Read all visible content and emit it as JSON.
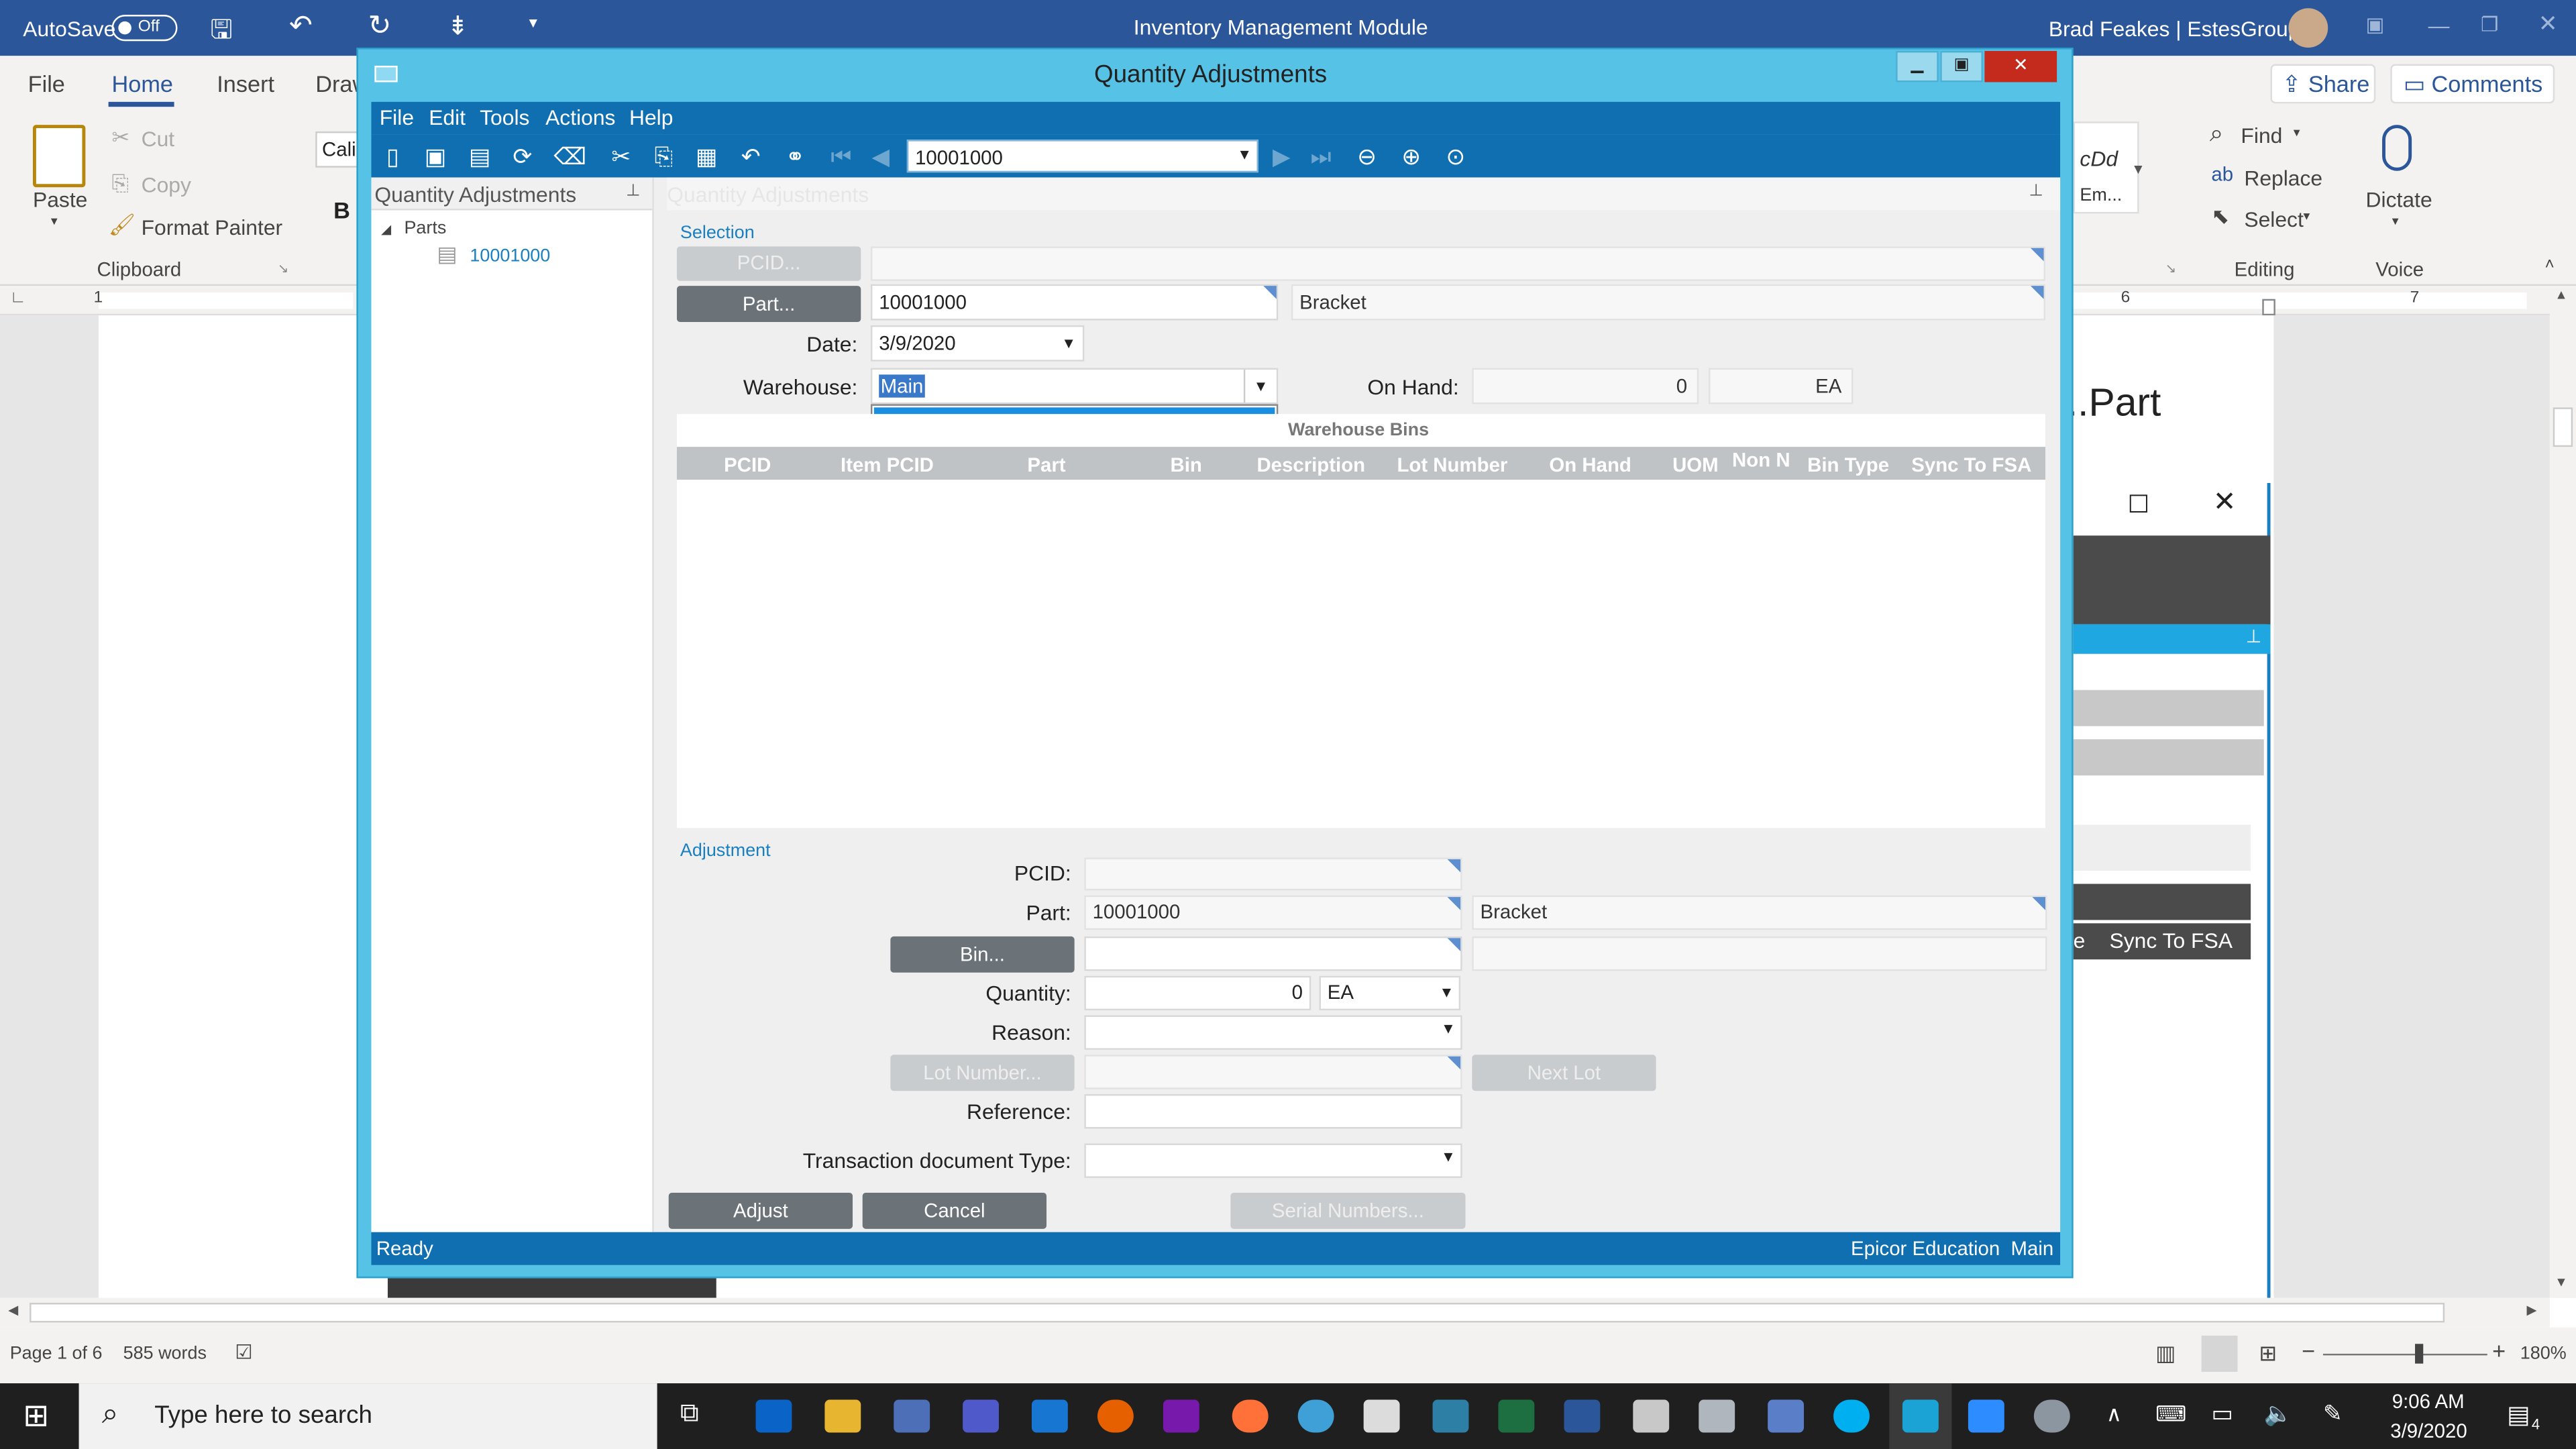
{
  "word": {
    "autosave_label": "AutoSave",
    "autosave_state": "Off",
    "window_title": "Inventory Management Module",
    "user": "Brad Feakes | EstesGroup",
    "tabs": [
      "File",
      "Home",
      "Insert",
      "Draw"
    ],
    "share": "Share",
    "comments": "Comments",
    "clipboard": {
      "paste": "Paste",
      "cut": "Cut",
      "copy": "Copy",
      "format_painter": "Format Painter",
      "group": "Clipboard",
      "font_box": "Cali",
      "bold": "B"
    },
    "editing": {
      "find": "Find",
      "replace": "Replace",
      "select": "Select",
      "group": "Editing"
    },
    "voice": {
      "dictate": "Dictate",
      "group": "Voice"
    },
    "style_preview": "cDd",
    "style_preview2": "Em...",
    "doc_heading": "..Part",
    "bg_grid_header": "Sync To FSA",
    "bg_grid_header_partial": "e",
    "ruler_marks": [
      "1",
      "6",
      "7"
    ],
    "status": {
      "page": "Page 1 of 6",
      "words": "585 words",
      "zoom": "180%"
    }
  },
  "dialog": {
    "title": "Quantity Adjustments",
    "menu": [
      "File",
      "Edit",
      "Tools",
      "Actions",
      "Help"
    ],
    "toolbar_part": "10001000",
    "tree_header": "Quantity Adjustments",
    "tree_root": "Parts",
    "tree_child": "10001000",
    "panel_header": "Quantity Adjustments",
    "selection": {
      "section": "Selection",
      "pcid_button": "PCID...",
      "part_button": "Part...",
      "part_value": "10001000",
      "part_desc": "Bracket",
      "date_label": "Date:",
      "date_value": "3/9/2020",
      "warehouse_label": "Warehouse:",
      "warehouse_value": "Main",
      "warehouse_options": [
        "Main"
      ],
      "onhand_label": "On Hand:",
      "onhand_value": "0",
      "onhand_uom": "EA",
      "bins_title": "Warehouse Bins",
      "columns": [
        "PCID",
        "Item PCID",
        "Part",
        "Bin",
        "Description",
        "Lot Number",
        "On Hand",
        "UOM",
        "Non N",
        "Bin Type",
        "Sync To FSA"
      ]
    },
    "adjustment": {
      "section": "Adjustment",
      "pcid_label": "PCID:",
      "part_label": "Part:",
      "part_value": "10001000",
      "part_desc": "Bracket",
      "bin_button": "Bin...",
      "quantity_label": "Quantity:",
      "quantity_value": "0",
      "quantity_uom": "EA",
      "reason_label": "Reason:",
      "lot_button": "Lot Number...",
      "next_lot_button": "Next Lot",
      "reference_label": "Reference:",
      "trans_type_label": "Transaction document Type:"
    },
    "buttons": {
      "adjust": "Adjust",
      "cancel": "Cancel",
      "serial": "Serial Numbers..."
    },
    "status_left": "Ready",
    "status_right": "Epicor Education  Main"
  },
  "taskbar": {
    "search_placeholder": "Type here to search",
    "time": "9:06 AM",
    "date": "3/9/2020",
    "notifications": "4"
  },
  "colors": {
    "word_blue": "#2b579a",
    "epicor_blue": "#0f6fb0",
    "dialog_frame": "#56c3e6",
    "close_red": "#c42b1c"
  }
}
